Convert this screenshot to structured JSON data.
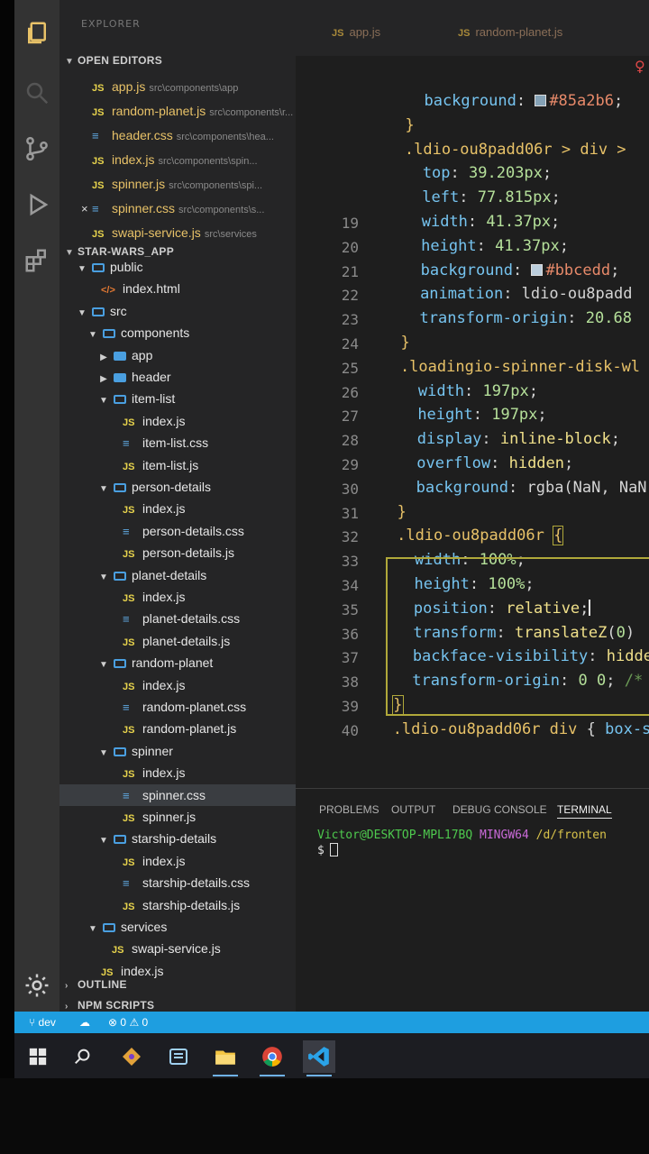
{
  "sidebar": {
    "title": "EXPLORER",
    "open_editors_title": "OPEN EDITORS",
    "open_editors": [
      {
        "name": "app.js",
        "type": "js",
        "path": "src\\components\\app"
      },
      {
        "name": "random-planet.js",
        "type": "js",
        "path": "src\\components\\r..."
      },
      {
        "name": "header.css",
        "type": "css",
        "path": "src\\components\\hea..."
      },
      {
        "name": "index.js",
        "type": "js",
        "path": "src\\components\\spin..."
      },
      {
        "name": "spinner.js",
        "type": "js",
        "path": "src\\components\\spi..."
      },
      {
        "name": "spinner.css",
        "type": "css",
        "path": "src\\components\\s...",
        "active": true
      },
      {
        "name": "swapi-service.js",
        "type": "js",
        "path": "src\\services"
      }
    ],
    "project_title": "STAR-WARS_APP",
    "tree": [
      {
        "name": "public",
        "kind": "folder",
        "depth": 1,
        "open": true
      },
      {
        "name": "index.html",
        "kind": "html",
        "depth": 2
      },
      {
        "name": "src",
        "kind": "folder",
        "depth": 1,
        "open": true
      },
      {
        "name": "components",
        "kind": "folder",
        "depth": 2,
        "open": true
      },
      {
        "name": "app",
        "kind": "folder",
        "depth": 3,
        "open": false
      },
      {
        "name": "header",
        "kind": "folder",
        "depth": 3,
        "open": false
      },
      {
        "name": "item-list",
        "kind": "folder",
        "depth": 3,
        "open": true
      },
      {
        "name": "index.js",
        "kind": "js",
        "depth": 4
      },
      {
        "name": "item-list.css",
        "kind": "css",
        "depth": 4
      },
      {
        "name": "item-list.js",
        "kind": "js",
        "depth": 4
      },
      {
        "name": "person-details",
        "kind": "folder",
        "depth": 3,
        "open": true
      },
      {
        "name": "index.js",
        "kind": "js",
        "depth": 4
      },
      {
        "name": "person-details.css",
        "kind": "css",
        "depth": 4
      },
      {
        "name": "person-details.js",
        "kind": "js",
        "depth": 4
      },
      {
        "name": "planet-details",
        "kind": "folder",
        "depth": 3,
        "open": true
      },
      {
        "name": "index.js",
        "kind": "js",
        "depth": 4
      },
      {
        "name": "planet-details.css",
        "kind": "css",
        "depth": 4
      },
      {
        "name": "planet-details.js",
        "kind": "js",
        "depth": 4
      },
      {
        "name": "random-planet",
        "kind": "folder",
        "depth": 3,
        "open": true
      },
      {
        "name": "index.js",
        "kind": "js",
        "depth": 4
      },
      {
        "name": "random-planet.css",
        "kind": "css",
        "depth": 4
      },
      {
        "name": "random-planet.js",
        "kind": "js",
        "depth": 4
      },
      {
        "name": "spinner",
        "kind": "folder",
        "depth": 3,
        "open": true
      },
      {
        "name": "index.js",
        "kind": "js",
        "depth": 4
      },
      {
        "name": "spinner.css",
        "kind": "css",
        "depth": 4,
        "selected": true
      },
      {
        "name": "spinner.js",
        "kind": "js",
        "depth": 4
      },
      {
        "name": "starship-details",
        "kind": "folder",
        "depth": 3,
        "open": true
      },
      {
        "name": "index.js",
        "kind": "js",
        "depth": 4
      },
      {
        "name": "starship-details.css",
        "kind": "css",
        "depth": 4
      },
      {
        "name": "starship-details.js",
        "kind": "js",
        "depth": 4
      },
      {
        "name": "services",
        "kind": "folder",
        "depth": 2,
        "open": true
      },
      {
        "name": "swapi-service.js",
        "kind": "js",
        "depth": 3
      },
      {
        "name": "index.js",
        "kind": "js",
        "depth": 2
      }
    ],
    "outline_title": "OUTLINE",
    "npm_title": "NPM SCRIPTS"
  },
  "tabs": [
    {
      "label": "app.js"
    },
    {
      "label": "random-planet.js"
    }
  ],
  "editor": {
    "lines": [
      {
        "num": "",
        "html": "<span class='prop'>  background</span><span class='punc'>: </span><span class='swatch' style='background:#85a2b6'></span><span class='str'>#85a2b6</span><span class='punc'>;</span>"
      },
      {
        "num": "",
        "html": "<span class='sel'>}</span>"
      },
      {
        "num": "",
        "html": "<span class='sel'>.ldio-ou8padd06r &gt; div &gt;</span>"
      },
      {
        "num": "",
        "html": "<span class='prop'>  top</span><span class='punc'>: </span><span class='num'>39.203px</span><span class='punc'>;</span>"
      },
      {
        "num": "",
        "html": "<span class='prop'>  left</span><span class='punc'>: </span><span class='num'>77.815px</span><span class='punc'>;</span>"
      },
      {
        "num": "19",
        "html": "<span class='prop'>  width</span><span class='punc'>: </span><span class='num'>41.37px</span><span class='punc'>;</span>"
      },
      {
        "num": "20",
        "html": "<span class='prop'>  height</span><span class='punc'>: </span><span class='num'>41.37px</span><span class='punc'>;</span>"
      },
      {
        "num": "21",
        "html": "<span class='prop'>  background</span><span class='punc'>: </span><span class='swatch' style='background:#bbcedd'></span><span class='str'>#bbcedd</span><span class='punc'>;</span>"
      },
      {
        "num": "22",
        "html": "<span class='prop'>  animation</span><span class='punc'>: ldio-ou8padd</span>"
      },
      {
        "num": "23",
        "html": "<span class='prop'>  transform-origin</span><span class='punc'>: </span><span class='num'>20.68</span>"
      },
      {
        "num": "24",
        "html": "<span class='sel'>}</span>"
      },
      {
        "num": "25",
        "html": "<span class='sel'>.loadingio-spinner-disk-wl</span>"
      },
      {
        "num": "26",
        "html": "<span class='prop'>  width</span><span class='punc'>: </span><span class='num'>197px</span><span class='punc'>;</span>"
      },
      {
        "num": "27",
        "html": "<span class='prop'>  height</span><span class='punc'>: </span><span class='num'>197px</span><span class='punc'>;</span>"
      },
      {
        "num": "28",
        "html": "<span class='prop'>  display</span><span class='punc'>: </span><span class='val'>inline-block</span><span class='punc'>;</span>"
      },
      {
        "num": "29",
        "html": "<span class='prop'>  overflow</span><span class='punc'>: </span><span class='val'>hidden</span><span class='punc'>;</span>"
      },
      {
        "num": "30",
        "html": "<span class='prop'>  background</span><span class='punc'>: rgba(NaN, NaN</span>"
      },
      {
        "num": "31",
        "html": "<span class='sel'>}</span>"
      },
      {
        "num": "32",
        "html": "<span class='sel'>.ldio-ou8padd06r </span><span class='sel' style='outline:1px solid #b0a83a'>{</span>"
      },
      {
        "num": "33",
        "html": "<span class='prop'>  width</span><span class='punc'>: </span><span class='num'>100%</span><span class='punc'>;</span>"
      },
      {
        "num": "34",
        "html": "<span class='prop'>  height</span><span class='punc'>: </span><span class='num'>100%</span><span class='punc'>;</span>"
      },
      {
        "num": "35",
        "html": "<span class='prop'>  position</span><span class='punc'>: </span><span class='val'>relative</span><span class='punc'>;</span><span id='cursor'></span>"
      },
      {
        "num": "36",
        "html": "<span class='prop'>  transform</span><span class='punc'>: </span><span class='val'>translateZ</span><span class='punc'>(</span><span class='num'>0</span><span class='punc'>)</span>"
      },
      {
        "num": "37",
        "html": "<span class='prop'>  backface-visibility</span><span class='punc'>: </span><span class='val'>hidde</span>"
      },
      {
        "num": "38",
        "html": "<span class='prop'>  transform-origin</span><span class='punc'>: </span><span class='num'>0 0</span><span class='punc'>; </span><span class='cmt'>/*</span>"
      },
      {
        "num": "39",
        "html": "<span class='sel' style='outline:1px solid #b0a83a'>}</span>"
      },
      {
        "num": "40",
        "html": "<span class='sel'>.ldio-ou8padd06r div </span><span class='punc'>{ </span><span class='prop'>box-s</span>"
      }
    ]
  },
  "panel": {
    "tabs": [
      {
        "label": "PROBLEMS"
      },
      {
        "label": "OUTPUT"
      },
      {
        "label": "DEBUG CONSOLE"
      },
      {
        "label": "TERMINAL",
        "active": true
      }
    ],
    "terminal": {
      "user": "Victor@DESKTOP-MPL17BQ",
      "host": "MINGW64",
      "path": "/d/fronten",
      "prompt": "$"
    }
  },
  "status_bar": {
    "branch": "dev",
    "errors": "0",
    "warnings": "0"
  },
  "colors": {
    "status_bar": "#1e9ee0",
    "activity_bar": "#333333",
    "sidebar": "#252526",
    "editor": "#1e1e1e"
  }
}
